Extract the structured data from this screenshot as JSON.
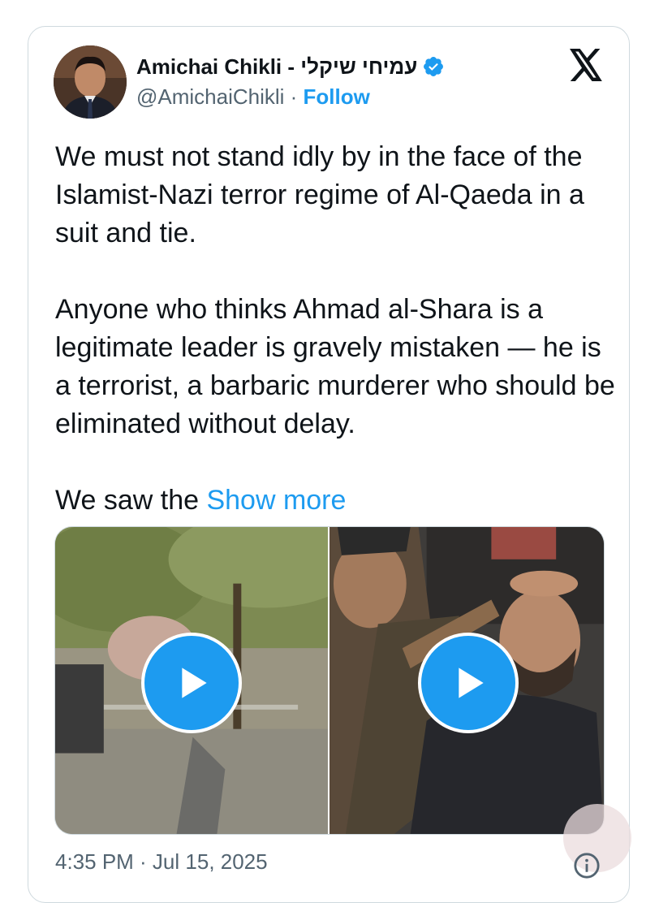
{
  "tweet": {
    "author": {
      "display_name": "Amichai Chikli - עמיחי שיקלי",
      "handle": "@AmichaiChikli",
      "separator": " · ",
      "follow_label": "Follow",
      "verified": true
    },
    "paragraphs": [
      "We must not stand idly by in the face of the Islamist-Nazi terror regime of Al-Qaeda in a suit and tie.",
      "Anyone who thinks Ahmad al-Shara is a legitimate leader is gravely mistaken — he is a terrorist, a barbaric murderer who should be eliminated without delay."
    ],
    "truncated_text": "We saw the ",
    "show_more_label": "Show more",
    "media": [
      {
        "type": "video",
        "icon": "play-icon"
      },
      {
        "type": "video",
        "icon": "play-icon"
      }
    ],
    "timestamp": "4:35 PM · Jul 15, 2025"
  },
  "icons": {
    "brand": "x-logo-icon",
    "verified": "verified-badge-icon",
    "info": "info-icon"
  },
  "colors": {
    "accent": "#1d9bf0",
    "text": "#0f1419",
    "secondary": "#536471",
    "border": "#cfd9de"
  }
}
